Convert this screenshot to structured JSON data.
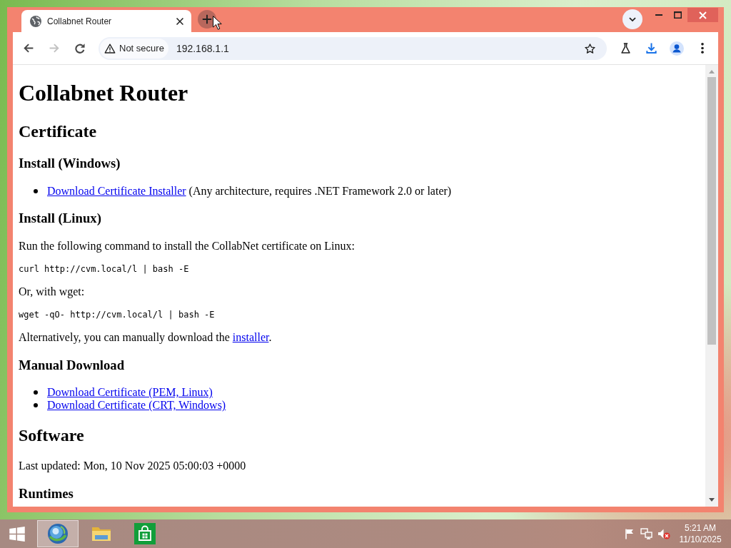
{
  "window": {
    "tabs": [
      {
        "title": "Collabnet Router",
        "selected": true
      }
    ],
    "new_tab_button": {
      "hovered": true
    }
  },
  "toolbar": {
    "nav_buttons": [
      {
        "kind": "back",
        "disabled": false
      },
      {
        "kind": "forward",
        "disabled": true
      },
      {
        "kind": "reload",
        "disabled": false
      }
    ],
    "security_chip": "Not secure",
    "url": "192.168.1.1"
  },
  "page": {
    "blocks": [
      {
        "kind": "h1",
        "text": "Collabnet Router"
      },
      {
        "kind": "h2",
        "text": "Certificate"
      },
      {
        "kind": "h3",
        "text": "Install (Windows)"
      },
      {
        "kind": "list",
        "items": [
          {
            "parts": [
              {
                "kind": "link",
                "text": "Download Certificate Installer"
              },
              {
                "kind": "text",
                "text": " (Any architecture, requires .NET Framework 2.0 or later)"
              }
            ]
          }
        ]
      },
      {
        "kind": "h3",
        "text": "Install (Linux)"
      },
      {
        "kind": "p",
        "parts": [
          {
            "kind": "text",
            "text": "Run the following command to install the CollabNet certificate on Linux:"
          }
        ]
      },
      {
        "kind": "code",
        "text": "curl http://cvm.local/l | bash -E"
      },
      {
        "kind": "p",
        "parts": [
          {
            "kind": "text",
            "text": "Or, with wget:"
          }
        ]
      },
      {
        "kind": "code",
        "text": "wget -qO- http://cvm.local/l | bash -E"
      },
      {
        "kind": "p",
        "parts": [
          {
            "kind": "text",
            "text": "Alternatively, you can manually download the "
          },
          {
            "kind": "link",
            "text": "installer"
          },
          {
            "kind": "text",
            "text": "."
          }
        ]
      },
      {
        "kind": "h3",
        "text": "Manual Download"
      },
      {
        "kind": "list",
        "items": [
          {
            "parts": [
              {
                "kind": "link",
                "text": "Download Certificate (PEM, Linux)"
              }
            ]
          },
          {
            "parts": [
              {
                "kind": "link",
                "text": "Download Certificate (CRT, Windows)"
              }
            ]
          }
        ]
      },
      {
        "kind": "h2",
        "text": "Software"
      },
      {
        "kind": "p",
        "parts": [
          {
            "kind": "text",
            "text": "Last updated: Mon, 10 Nov 2025 05:00:03 +0000"
          }
        ]
      },
      {
        "kind": "h3",
        "text": "Runtimes"
      }
    ]
  },
  "taskbar": {
    "apps": [
      {
        "kind": "browser",
        "selected": true
      },
      {
        "kind": "file-explorer",
        "selected": false
      },
      {
        "kind": "store",
        "selected": false
      }
    ],
    "tray": [
      {
        "kind": "flag"
      },
      {
        "kind": "network"
      },
      {
        "kind": "volume-muted"
      }
    ],
    "clock": {
      "time": "5:21 AM",
      "date": "11/10/2025"
    }
  }
}
